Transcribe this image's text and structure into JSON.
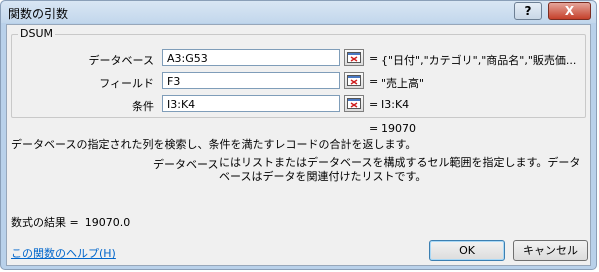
{
  "window": {
    "title": "関数の引数",
    "help_glyph": "?",
    "close_glyph": "X"
  },
  "function_group": {
    "name": "DSUM",
    "args": [
      {
        "label": "データベース",
        "input": "A3:G53",
        "result": "{\"日付\",\"カテゴリ\",\"商品名\",\"販売価..."
      },
      {
        "label": "フィールド",
        "input": "F3",
        "result": "\"売上高\""
      },
      {
        "label": "条件",
        "input": "I3:K4",
        "result": "I3:K4"
      }
    ]
  },
  "function_result": {
    "eq": "=",
    "value": "19070"
  },
  "function_description": "データベースの指定された列を検索し、条件を満たすレコードの合計を返します。",
  "arg_description": {
    "name": "データベース",
    "text": "にはリストまたはデータベースを構成するセル範囲を指定します。データベースはデータを関連付けたリストです。"
  },
  "formula_result": {
    "label": "数式の結果 =",
    "value": "19070.0"
  },
  "help_link": "この関数のヘルプ(H)",
  "buttons": {
    "ok": "OK",
    "cancel": "キャンセル"
  },
  "icons": {
    "ref": "collapse-dialog-icon"
  }
}
